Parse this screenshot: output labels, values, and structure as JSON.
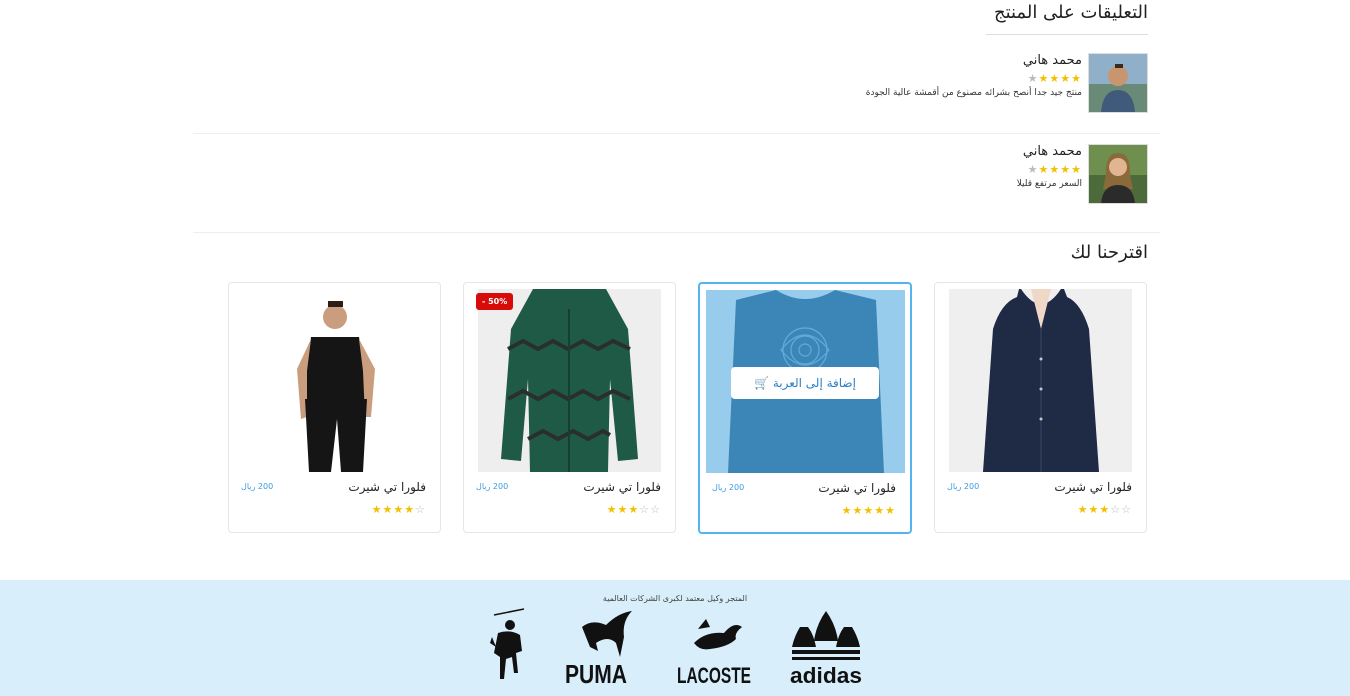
{
  "comments_section": {
    "title": "التعليقات على المنتج",
    "comments": [
      {
        "name": "محمد هاني",
        "stars": 4,
        "text": "منتج جيد جدا أنصح بشرائه مصنوع من أقمشة عالية الجودة"
      },
      {
        "name": "محمد هاني",
        "stars": 4,
        "text": "السعر مرتفع قليلا"
      }
    ]
  },
  "suggestions": {
    "title": "اقترحنا لك",
    "products": [
      {
        "name": "فلورا تي شيرت",
        "price": "200 ريال",
        "rating": 3,
        "image": "blouse-image"
      },
      {
        "name": "فلورا تي شيرت",
        "price": "200 ريال",
        "rating": 5,
        "image": "tshirt-image",
        "add_to_cart": "إضافة إلى العربة"
      },
      {
        "name": "فلورا تي شيرت",
        "price": "200 ريال",
        "rating": 3,
        "image": "jacket-image",
        "badge": "- 50%"
      },
      {
        "name": "فلورا تي شيرت",
        "price": "200 ريال",
        "rating": 4,
        "image": "man-image"
      }
    ]
  },
  "footer": {
    "text": "المتجر وكيل معتمد لكبرى الشركات العالمية",
    "brands": [
      {
        "name": "POLO",
        "logo": "polo-logo"
      },
      {
        "name": "PUMA",
        "logo": "puma-logo"
      },
      {
        "name": "LACOSTE",
        "logo": "lacoste-logo"
      },
      {
        "name": "adidas",
        "logo": "adidas-logo"
      }
    ]
  },
  "colors": {
    "accent": "#54b4ef",
    "star": "#f2c000",
    "badge": "#d80b0b",
    "footer_bg": "#d8effb",
    "price": "#3a9be0"
  }
}
